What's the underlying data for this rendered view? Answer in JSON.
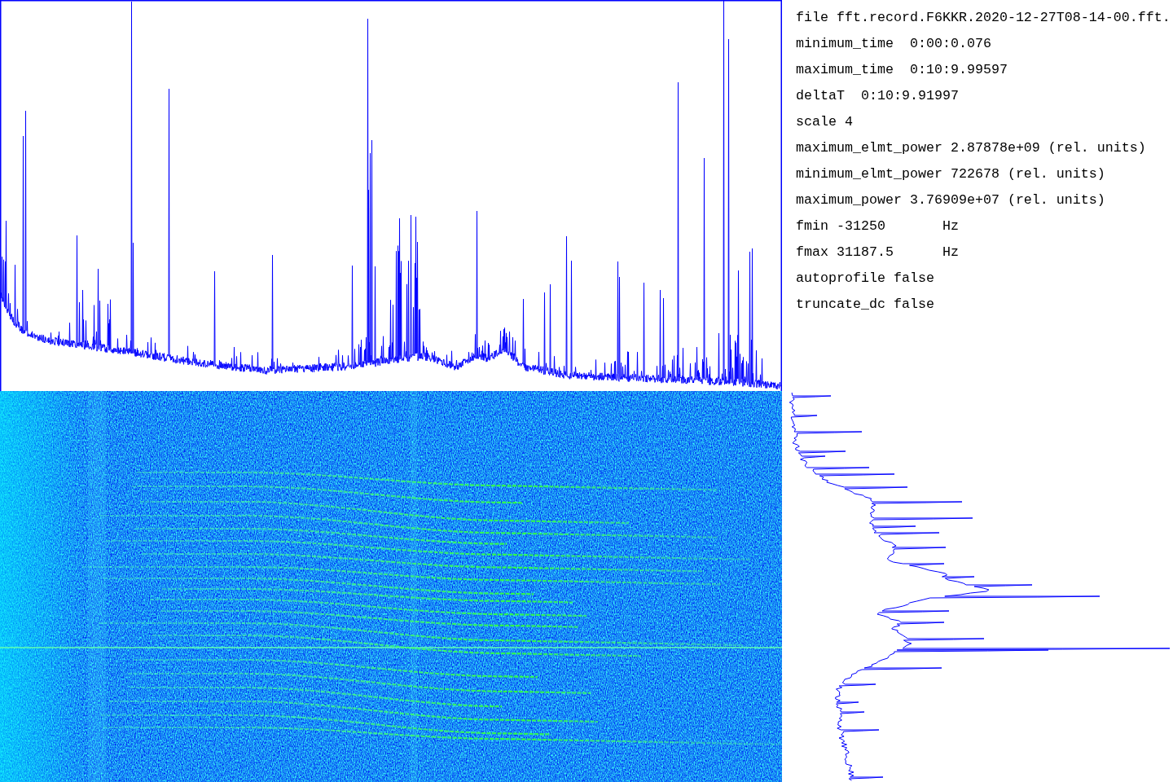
{
  "parameters_panel": {
    "lines": [
      {
        "text": "file fft.record.F6KKR.2020-12-27T08-14-00.fft."
      },
      {
        "text": "minimum_time  0:00:0.076"
      },
      {
        "text": "maximum_time  0:10:9.99597"
      },
      {
        "text": "deltaT  0:10:9.91997"
      },
      {
        "text": "scale 4"
      },
      {
        "text": "maximum_elmt_power 2.87878e+09 (rel. units)"
      },
      {
        "text": "minimum_elmt_power 722678 (rel. units)"
      },
      {
        "text": "maximum_power 3.76909e+07 (rel. units)"
      },
      {
        "text": "fmin -31250",
        "unit": "Hz"
      },
      {
        "text": "fmax 31187.5",
        "unit": "Hz"
      },
      {
        "text": "autoprofile false"
      },
      {
        "text": "truncate_dc false"
      }
    ]
  }
}
